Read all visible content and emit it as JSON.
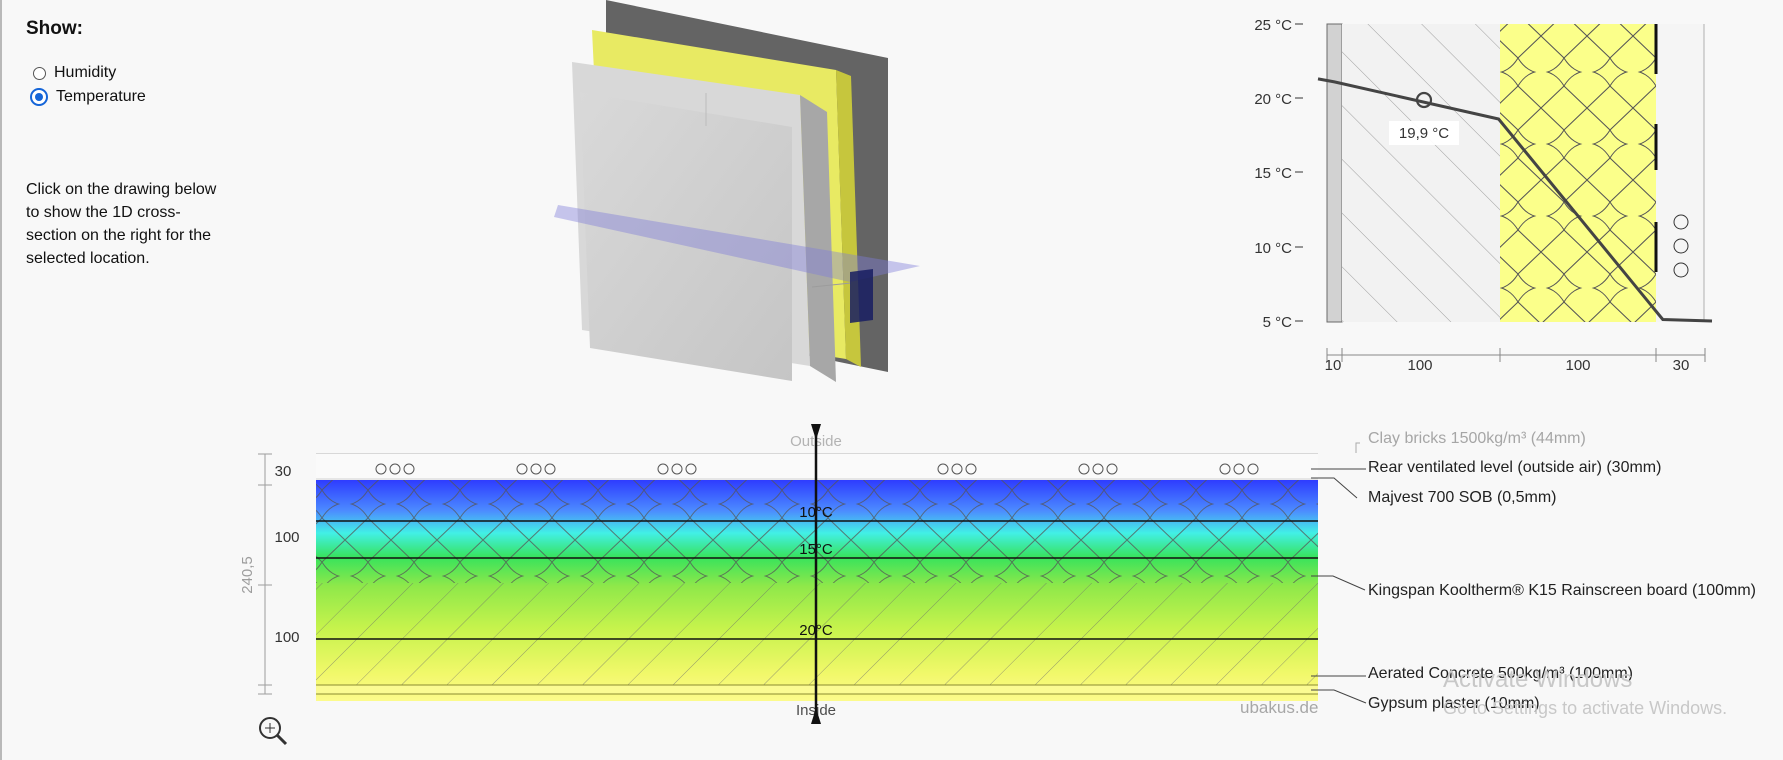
{
  "sidebar": {
    "title": "Show:",
    "options": [
      {
        "label": "Humidity",
        "selected": false
      },
      {
        "label": "Temperature",
        "selected": true
      }
    ],
    "instructions": "Click on the drawing below to show the 1D cross-section on the right for the selected location."
  },
  "chart_data": {
    "type": "line",
    "title": "",
    "xlabel": "",
    "ylabel": "",
    "y_ticks": [
      "25 °C",
      "20 °C",
      "15 °C",
      "10 °C",
      "5 °C"
    ],
    "x_thickness_labels": [
      "10",
      "100",
      "100",
      "30"
    ],
    "x_mm": [
      0,
      10,
      110,
      210,
      240
    ],
    "temperature_c": [
      21.3,
      21.1,
      18.6,
      5.1,
      5.0
    ],
    "marker_value": "19,9 °C",
    "ylim": [
      5,
      25
    ]
  },
  "section": {
    "outside_label": "Outside",
    "inside_label": "Inside",
    "total_label": "240,5",
    "thickness_labels": [
      "30",
      "100",
      "100"
    ],
    "isotherm_labels": [
      "10°C",
      "15°C",
      "20°C"
    ],
    "layers": [
      "Clay bricks 1500kg/m³ (44mm)",
      "Rear ventilated level (outside air) (30mm)",
      "Majvest 700 SOB (0,5mm)",
      "Kingspan Kooltherm® K15 Rainscreen board (100mm)",
      "Aerated Concrete 500kg/m³ (100mm)",
      "Gypsum plaster (10mm)"
    ],
    "brand": "ubakus.de",
    "zoom_icon": "zoom-in-icon"
  },
  "watermark": {
    "title": "Activate Windows",
    "subtitle": "Go to Settings to activate Windows."
  }
}
